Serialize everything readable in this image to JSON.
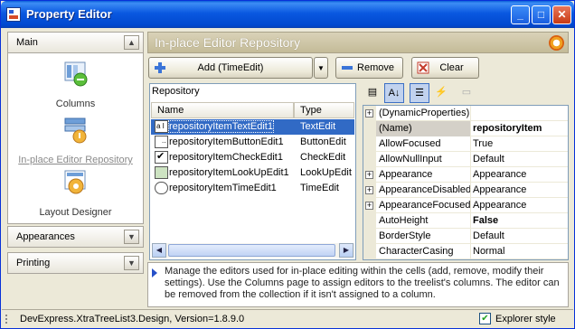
{
  "window": {
    "title": "Property Editor"
  },
  "nav": {
    "groups": [
      {
        "label": "Main"
      },
      {
        "label": "Appearances"
      },
      {
        "label": "Printing"
      }
    ],
    "items": [
      {
        "label": "Columns",
        "icon": "columns-icon"
      },
      {
        "label": "In-place Editor Repository",
        "icon": "repository-icon"
      },
      {
        "label": "Layout Designer",
        "icon": "layout-designer-icon"
      }
    ]
  },
  "header": {
    "title": "In-place Editor Repository"
  },
  "toolbar": {
    "add_label": "Add (TimeEdit)",
    "remove_label": "Remove",
    "clear_label": "Clear"
  },
  "repository": {
    "title": "Repository",
    "columns": [
      "Name",
      "Type"
    ],
    "rows": [
      {
        "name": "repositoryItemTextEdit1",
        "type": "TextEdit",
        "selected": true
      },
      {
        "name": "repositoryItemButtonEdit1",
        "type": "ButtonEdit"
      },
      {
        "name": "repositoryItemCheckEdit1",
        "type": "CheckEdit"
      },
      {
        "name": "repositoryItemLookUpEdit1",
        "type": "LookUpEdit"
      },
      {
        "name": "repositoryItemTimeEdit1",
        "type": "TimeEdit"
      }
    ]
  },
  "properties": {
    "rows": [
      {
        "name": "(DynamicProperties)",
        "value": "",
        "expand": true
      },
      {
        "name": "(Name)",
        "value": "repositoryItem",
        "bold": true
      },
      {
        "name": "AllowFocused",
        "value": "True"
      },
      {
        "name": "AllowNullInput",
        "value": "Default"
      },
      {
        "name": "Appearance",
        "value": "Appearance",
        "expand": true
      },
      {
        "name": "AppearanceDisabled",
        "value": "Appearance",
        "expand": true
      },
      {
        "name": "AppearanceFocused",
        "value": "Appearance",
        "expand": true
      },
      {
        "name": "AutoHeight",
        "value": "False",
        "bold": true
      },
      {
        "name": "BorderStyle",
        "value": "Default"
      },
      {
        "name": "CharacterCasing",
        "value": "Normal"
      }
    ]
  },
  "description": "Manage the editors used for in-place editing within the cells (add, remove, modify their settings). Use the Columns page to assign editors to the treelist's columns. The editor can be removed from the collection if it isn't assigned to a column.",
  "status": {
    "text": "DevExpress.XtraTreeList3.Design, Version=1.8.9.0",
    "explorer_style_label": "Explorer style",
    "explorer_style_checked": true
  }
}
